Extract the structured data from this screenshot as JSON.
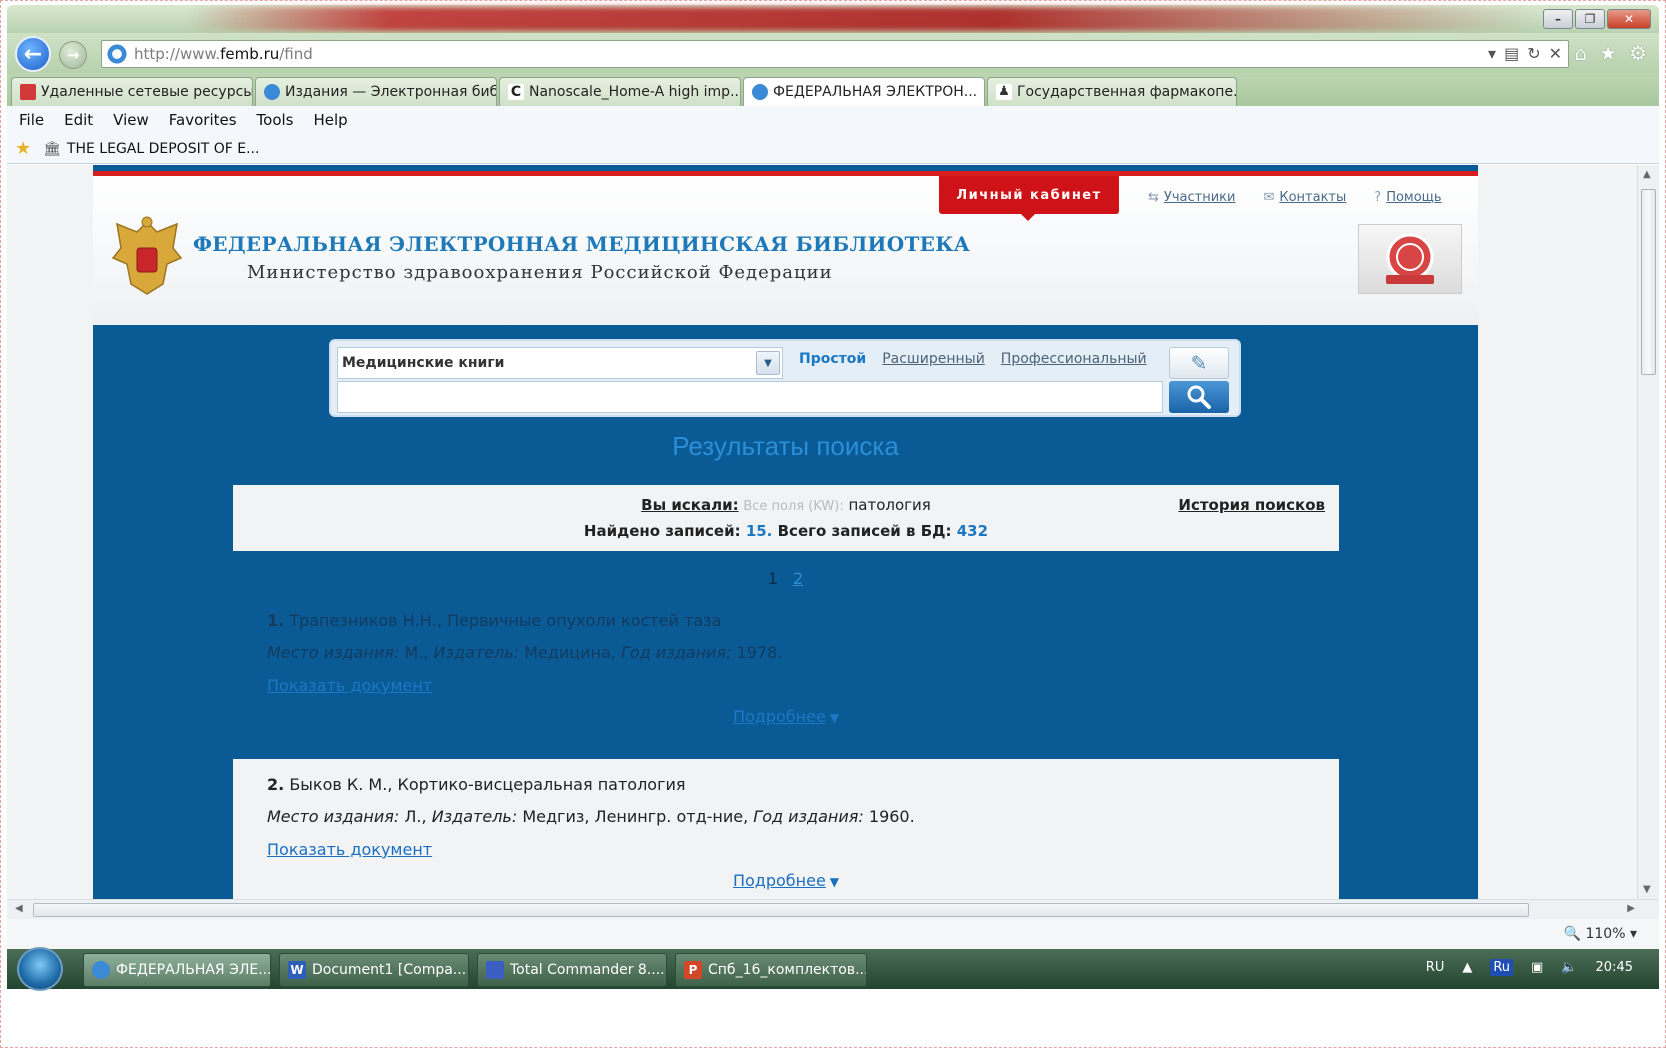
{
  "browser": {
    "address": {
      "prefix": "http://www.",
      "domain": "femb.ru",
      "path": "/find"
    },
    "tabs": [
      {
        "label": "Удаленные сетевые ресурсы ...",
        "icon": "red-bookmark-icon",
        "color": "#d23a3a"
      },
      {
        "label": "Издания — Электронная биб...",
        "icon": "ie-page-icon",
        "color": "#3b8ad8"
      },
      {
        "label": "Nanoscale_Home-A high imp...",
        "icon": "c-logo-icon",
        "color": "#222222"
      },
      {
        "label": "ФЕДЕРАЛЬНАЯ ЭЛЕКТРОН...",
        "icon": "ie-page-icon",
        "color": "#3b8ad8"
      },
      {
        "label": "Государственная фармакопе...",
        "icon": "penguin-icon",
        "color": "#333333"
      }
    ],
    "menu": [
      "File",
      "Edit",
      "View",
      "Favorites",
      "Tools",
      "Help"
    ],
    "favorites": {
      "item": "THE LEGAL DEPOSIT OF E..."
    },
    "zoom": "110%"
  },
  "site": {
    "title": "ФЕДЕРАЛЬНАЯ ЭЛЕКТРОННАЯ МЕДИЦИНСКАЯ БИБЛИОТЕКА",
    "subtitle": "Министерство здравоохранения Российской Федерации",
    "cabinet": "Личный кабинет",
    "top_links": [
      "Участники",
      "Контакты",
      "Помощь"
    ],
    "accent": "#cf1218",
    "brand_blue": "#0a5a96"
  },
  "search": {
    "collection": "Медицинские книги",
    "modes": {
      "simple": "Простой",
      "advanced": "Расширенный",
      "professional": "Профессиональный"
    },
    "query": ""
  },
  "results": {
    "heading": "Результаты поиска",
    "you_searched_label": "Вы искали:",
    "field_label": "Все поля (KW):",
    "query_term": "патология",
    "history_label": "История поисков",
    "found_label": "Найдено записей:",
    "found_count": "15.",
    "total_label": "Всего записей в БД:",
    "total_count": "432",
    "pages": {
      "current": "1",
      "next": "2"
    },
    "items": [
      {
        "num": "1.",
        "title": "Трапезников Н.Н., Первичные опухоли костей таза",
        "place_label": "Место издания:",
        "place": "М.,",
        "publisher_label": "Издатель:",
        "publisher": "Медицина,",
        "year_label": "Год издания:",
        "year": "1978.",
        "show_doc": "Показать документ",
        "more": "Подробнее"
      },
      {
        "num": "2.",
        "title": "Быков К. М., Кортико-висцеральная патология",
        "place_label": "Место издания:",
        "place": "Л.,",
        "publisher_label": "Издатель:",
        "publisher": "Медгиз, Ленингр. отд-ние,",
        "year_label": "Год издания:",
        "year": "1960.",
        "show_doc": "Показать документ",
        "more": "Подробнее"
      }
    ]
  },
  "taskbar": {
    "tasks": [
      {
        "label": "ФЕДЕРАЛЬНАЯ ЭЛЕ...",
        "icon": "ie-page-icon",
        "color": "#3b8ad8"
      },
      {
        "label": "Document1 [Compa...",
        "icon": "word-icon",
        "color": "#2b5fb8"
      },
      {
        "label": "Total Commander 8....",
        "icon": "floppy-icon",
        "color": "#3a5fc0"
      },
      {
        "label": "Спб_16_комплектов...",
        "icon": "powerpoint-icon",
        "color": "#d24726"
      }
    ],
    "language": "RU",
    "lang_badge": "Ru",
    "clock": "20:45"
  }
}
